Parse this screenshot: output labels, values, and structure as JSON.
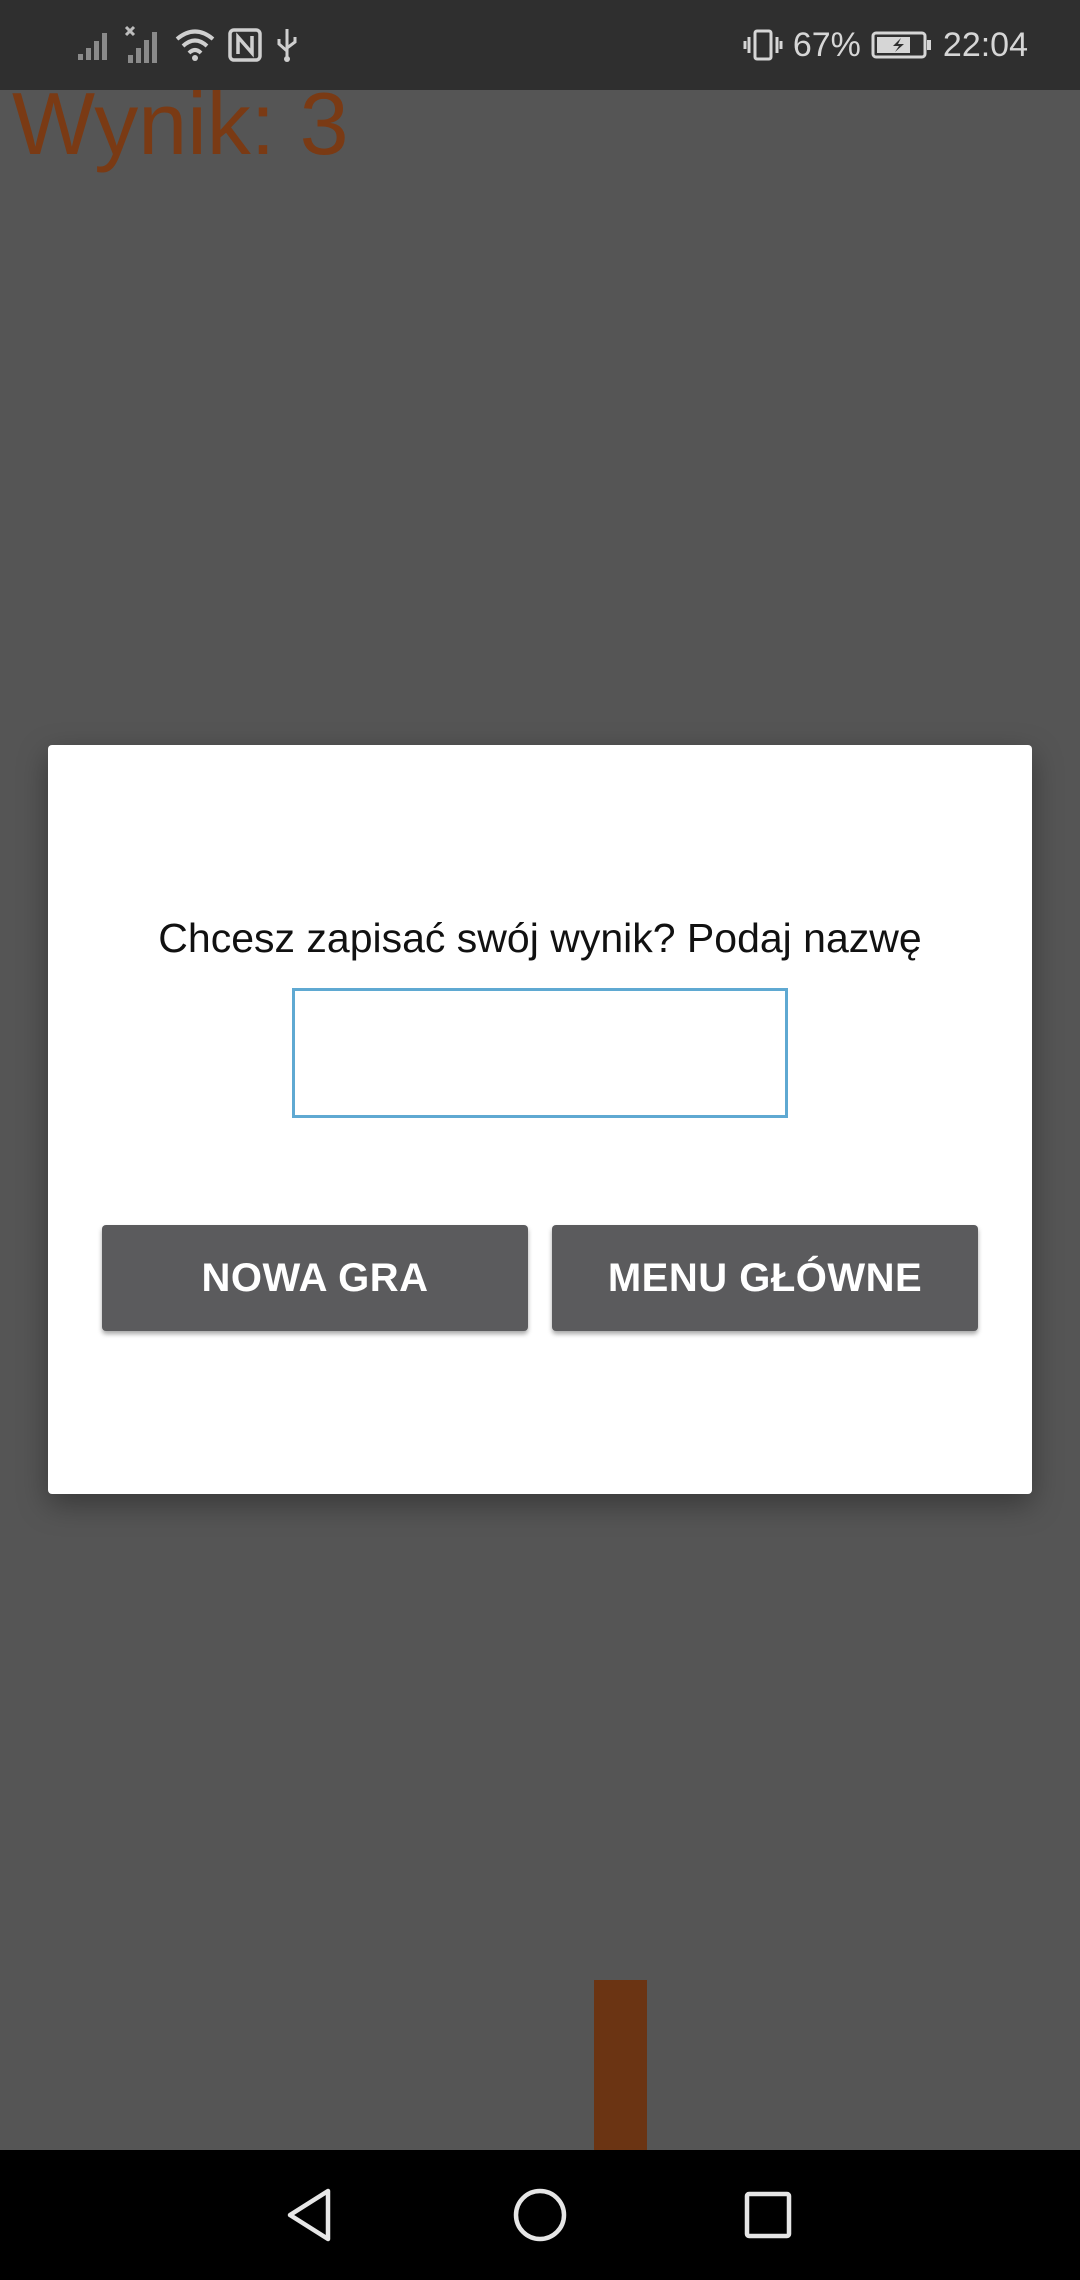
{
  "status_bar": {
    "battery_percent": "67%",
    "time": "22:04",
    "icons_left": [
      "signal-icon",
      "signal-no-sim-icon",
      "wifi-icon",
      "nfc-icon",
      "usb-icon"
    ],
    "icons_right": [
      "vibrate-icon",
      "battery-charging-icon"
    ]
  },
  "game": {
    "score_text": "Wynik: 3",
    "score_color": "#7a3a14",
    "pillar_color": "#6b3413",
    "background_color": "#555555"
  },
  "dialog": {
    "message": "Chcesz zapisać swój wynik? Podaj nazwę",
    "name_input": {
      "value": "",
      "placeholder": ""
    },
    "new_game_label": "NOWA GRA",
    "main_menu_label": "MENU GŁÓWNE",
    "button_color": "#5b5b5d",
    "input_border_color": "#5fa9d2"
  },
  "nav_bar": {
    "icons": [
      "back-icon",
      "home-icon",
      "recents-icon"
    ]
  }
}
